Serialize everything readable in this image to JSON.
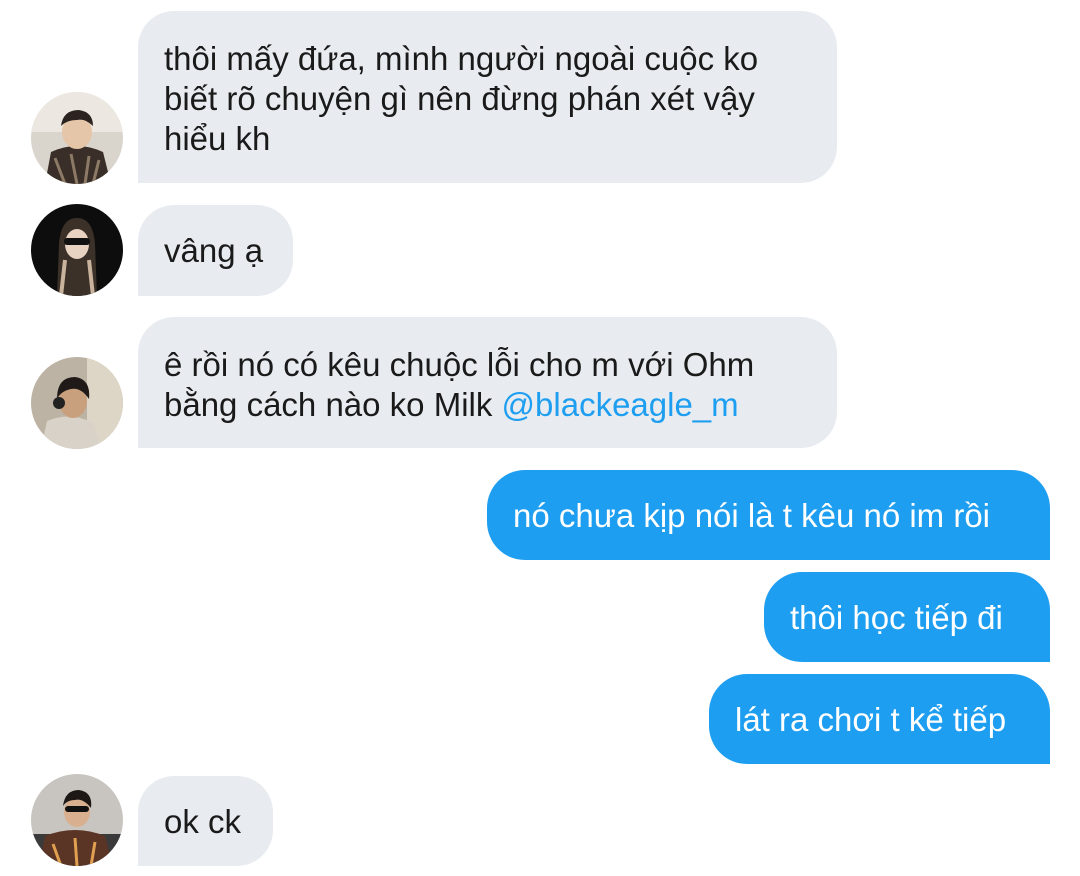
{
  "conversation": {
    "messages": [
      {
        "direction": "incoming",
        "avatar_icon": "user-avatar-1",
        "lines": [
          "thôi mấy đứa, mình người ngoài cuộc ko",
          "biết rõ chuyện gì nên đừng phán xét vậy",
          "hiểu kh"
        ]
      },
      {
        "direction": "incoming",
        "avatar_icon": "user-avatar-2",
        "lines": [
          "vâng ạ"
        ]
      },
      {
        "direction": "incoming",
        "avatar_icon": "user-avatar-3",
        "lines": [
          "ê rồi nó có kêu chuộc lỗi cho m với Ohm",
          "bằng cách nào ko Milk"
        ],
        "mention": "@blackeagle_m"
      },
      {
        "direction": "outgoing",
        "lines": [
          "nó chưa kịp nói là t kêu nó im rồi"
        ]
      },
      {
        "direction": "outgoing",
        "lines": [
          "thôi học tiếp đi"
        ]
      },
      {
        "direction": "outgoing",
        "lines": [
          "lát ra chơi t kể tiếp"
        ]
      },
      {
        "direction": "incoming",
        "avatar_icon": "user-avatar-4",
        "lines": [
          "ok ck"
        ]
      }
    ]
  },
  "colors": {
    "incoming_bubble": "#e8ecf0",
    "outgoing_bubble": "#1e9ef0",
    "mention": "#1e9ef0",
    "incoming_text": "#1a1a1a",
    "outgoing_text": "#ffffff"
  }
}
